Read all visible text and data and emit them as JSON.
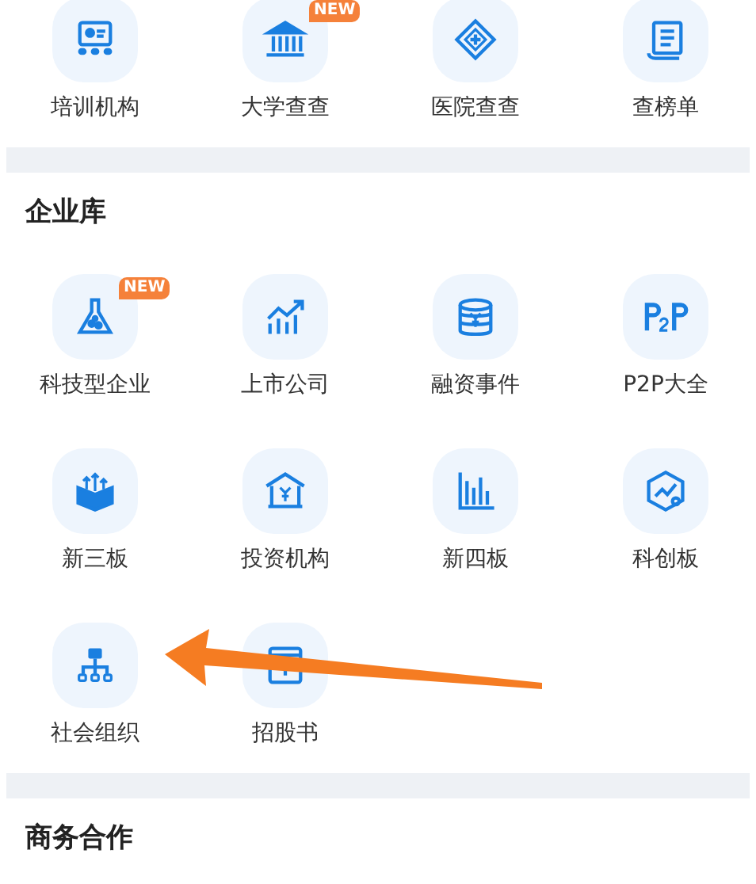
{
  "sections": [
    {
      "items": [
        {
          "kind": "training",
          "label": "培训机构"
        },
        {
          "kind": "university",
          "label": "大学查查",
          "badge": "NEW"
        },
        {
          "kind": "hospital",
          "label": "医院查查"
        },
        {
          "kind": "list",
          "label": "查榜单"
        }
      ]
    },
    {
      "title": "企业库",
      "items": [
        {
          "kind": "flask",
          "label": "科技型企业",
          "badge": "NEW"
        },
        {
          "kind": "growth",
          "label": "上市公司"
        },
        {
          "kind": "coins",
          "label": "融资事件"
        },
        {
          "kind": "p2p",
          "label": "P2P大全"
        },
        {
          "kind": "cube",
          "label": "新三板"
        },
        {
          "kind": "bank",
          "label": "投资机构"
        },
        {
          "kind": "bars",
          "label": "新四板"
        },
        {
          "kind": "hexagon",
          "label": "科创板"
        },
        {
          "kind": "org",
          "label": "社会组织"
        },
        {
          "kind": "book",
          "label": "招股书"
        }
      ]
    },
    {
      "title": "商务合作"
    }
  ],
  "overlay": {
    "kind": "arrow"
  }
}
